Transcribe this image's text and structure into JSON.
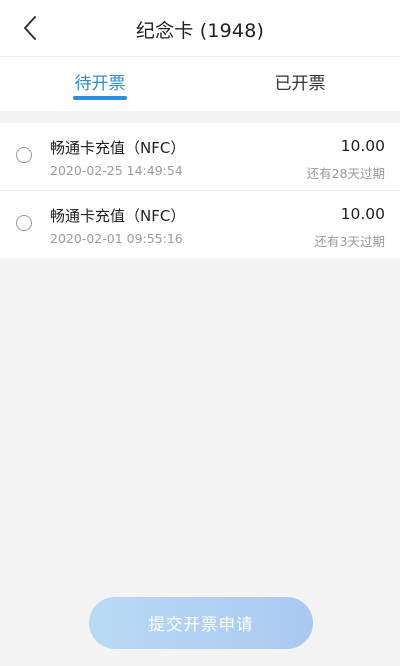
{
  "header": {
    "title": "纪念卡 (1948)",
    "back_icon": "chevron-left-icon"
  },
  "tabs": [
    {
      "label": "待开票",
      "active": true
    },
    {
      "label": "已开票",
      "active": false
    }
  ],
  "records": [
    {
      "title": "畅通卡充值（NFC）",
      "date": "2020-02-25 14:49:54",
      "amount": "10.00",
      "expiry": "还有28天过期",
      "selected": false
    },
    {
      "title": "畅通卡充值（NFC）",
      "date": "2020-02-01 09:55:16",
      "amount": "10.00",
      "expiry": "还有3天过期",
      "selected": false
    }
  ],
  "submit": {
    "label": "提交开票申请",
    "enabled": false
  },
  "colors": {
    "accent": "#2b8ce0",
    "background": "#f4f4f5",
    "muted_text": "#9b9b9b",
    "button_start": "#b8dbf5",
    "button_end": "#aac9f1"
  }
}
